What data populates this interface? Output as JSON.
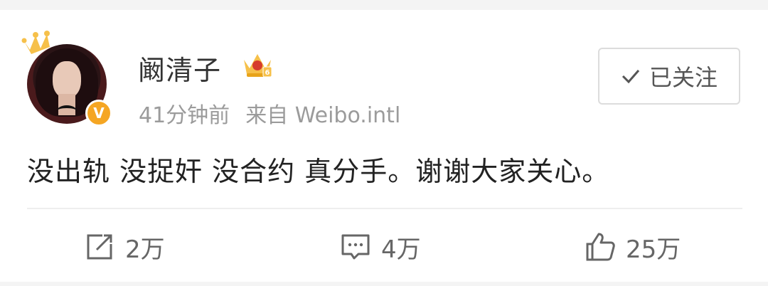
{
  "post": {
    "username": "阚清子",
    "time": "41分钟前",
    "source": "来自 Weibo.intl",
    "follow_label": "已关注",
    "content": "没出轨 没捉奸 没合约 真分手。谢谢大家关心。",
    "verified_symbol": "V"
  },
  "actions": {
    "repost_count": "2万",
    "comment_count": "4万",
    "like_count": "25万"
  },
  "colors": {
    "crown": "#f6c04a",
    "verified": "#f5a623",
    "text_primary": "#333333",
    "text_secondary": "#9b9b9b"
  },
  "icons": [
    "crown-icon",
    "member-crown-icon",
    "check-icon",
    "repost-icon",
    "comment-icon",
    "like-icon"
  ]
}
